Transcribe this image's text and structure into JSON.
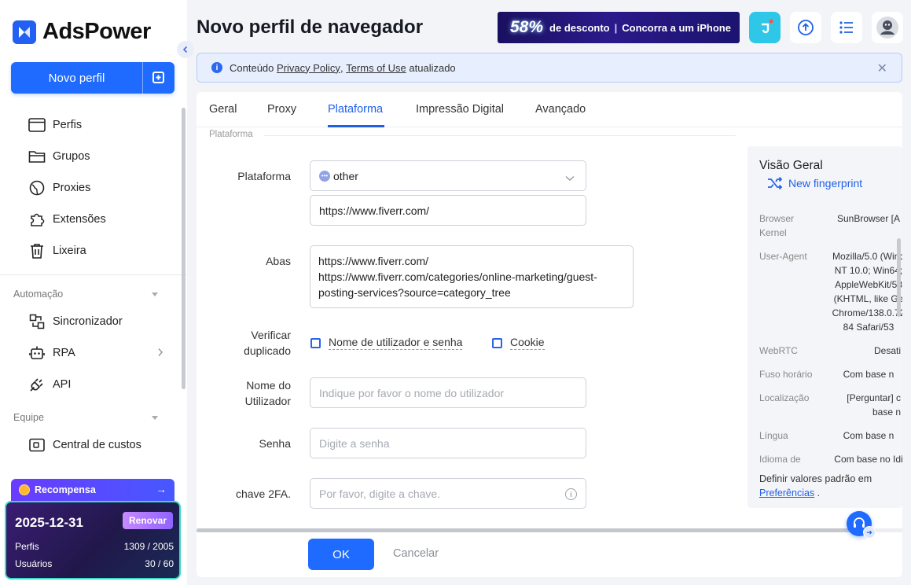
{
  "app": {
    "name": "AdsPower"
  },
  "sidebar": {
    "new_profile_label": "Novo perfil",
    "items": [
      {
        "label": "Perfis",
        "icon": "browser-window-icon"
      },
      {
        "label": "Grupos",
        "icon": "folder-icon"
      },
      {
        "label": "Proxies",
        "icon": "globe-icon"
      },
      {
        "label": "Extensões",
        "icon": "puzzle-icon"
      },
      {
        "label": "Lixeira",
        "icon": "trash-icon"
      }
    ],
    "automation": {
      "title": "Automação",
      "items": [
        {
          "label": "Sincronizador",
          "icon": "sync-icon"
        },
        {
          "label": "RPA",
          "icon": "robot-icon"
        },
        {
          "label": "API",
          "icon": "plug-icon"
        }
      ]
    },
    "team": {
      "title": "Equipe",
      "items": [
        {
          "label": "Central de custos",
          "icon": "wallet-icon"
        }
      ]
    },
    "reward": {
      "label": "Recompensa",
      "arrow": "→"
    },
    "plan": {
      "expiry": "2025-12-31",
      "renew_label": "Renovar",
      "profiles_label": "Perfis",
      "profiles_value": "1309 / 2005",
      "users_label": "Usuários",
      "users_value": "30 / 60"
    }
  },
  "header": {
    "title": "Novo perfil de navegador",
    "promo": {
      "percent": "58%",
      "text1": "de desconto",
      "sep": "|",
      "text2": "Concorra a um iPhone"
    }
  },
  "notice": {
    "prefix": "Conteúdo",
    "link1": "Privacy Policy",
    "comma": ",",
    "link2": "Terms of Use",
    "suffix": "atualizado"
  },
  "tabs": [
    {
      "label": "Geral"
    },
    {
      "label": "Proxy"
    },
    {
      "label": "Plataforma"
    },
    {
      "label": "Impressão Digital"
    },
    {
      "label": "Avançado"
    }
  ],
  "form": {
    "group_label": "Plataforma",
    "platform_label": "Plataforma",
    "platform_value": "other",
    "platform_url": "https://www.fiverr.com/",
    "tabs_label": "Abas",
    "tabs_value": "https://www.fiverr.com/\nhttps://www.fiverr.com/categories/online-marketing/guest-posting-services?source=category_tree",
    "dup_label_1": "Verificar",
    "dup_label_2": "duplicado",
    "dup_opt_1": "Nome de utilizador e senha",
    "dup_opt_2": "Cookie",
    "username_label_1": "Nome do",
    "username_label_2": "Utilizador",
    "username_placeholder": "Indique por favor o nome do utilizador",
    "password_label": "Senha",
    "password_placeholder": "Digite a senha",
    "twofa_label": "chave 2FA.",
    "twofa_placeholder": "Por favor, digite a chave."
  },
  "overview": {
    "title": "Visão Geral",
    "new_fingerprint": "New fingerprint",
    "rows": [
      {
        "key": "Browser Kernel",
        "val": "SunBrowser [A"
      },
      {
        "key": "User-Agent",
        "val": "Mozilla/5.0 (Wind\nNT 10.0; Win64;\nAppleWebKit/53\n(KHTML, like Ge\nChrome/138.0.72\n84 Safari/53"
      },
      {
        "key": "WebRTC",
        "val": "Desati"
      },
      {
        "key": "Fuso horário",
        "val": "Com base n"
      },
      {
        "key": "Localização",
        "val": "[Perguntar] c\nbase n"
      },
      {
        "key": "Língua",
        "val": "Com base n"
      },
      {
        "key": "Idioma de",
        "val": "Com base no Idi"
      }
    ],
    "footer_text": "Definir valores padrão em",
    "footer_link": "Preferências",
    "footer_end": "."
  },
  "actions": {
    "ok": "OK",
    "cancel": "Cancelar"
  },
  "colors": {
    "accent": "#1f6bff",
    "tab_active": "#1f5fe8"
  }
}
